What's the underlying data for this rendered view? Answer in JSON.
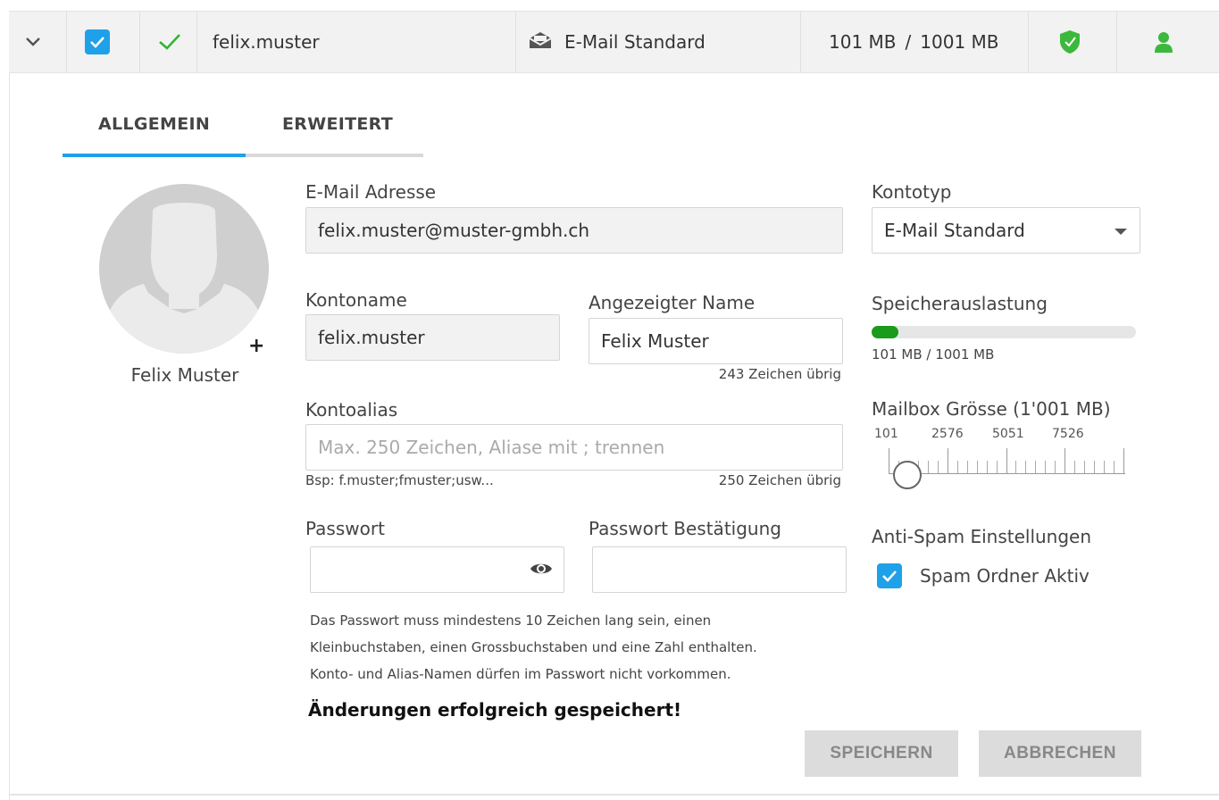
{
  "row": {
    "username": "felix.muster",
    "account_type": "E-Mail Standard",
    "quota_used": "101 MB",
    "quota_sep": "/",
    "quota_total": "1001 MB"
  },
  "tabs": [
    {
      "label": "ALLGEMEIN"
    },
    {
      "label": "ERWEITERT"
    }
  ],
  "profile": {
    "name": "Felix Muster",
    "add_label": "+"
  },
  "form": {
    "email_label": "E-Mail Adresse",
    "email_value": "felix.muster@muster-gmbh.ch",
    "kontoname_label": "Kontoname",
    "kontoname_value": "felix.muster",
    "display_name_label": "Angezeigter Name",
    "display_name_value": "Felix Muster",
    "display_name_remaining": "243 Zeichen übrig",
    "alias_label": "Kontoalias",
    "alias_placeholder": "Max. 250 Zeichen, Aliase mit ; trennen",
    "alias_example": "Bsp: f.muster;fmuster;usw...",
    "alias_remaining": "250 Zeichen übrig",
    "password_label": "Passwort",
    "password_confirm_label": "Passwort Bestätigung",
    "password_note_1": "Das Passwort muss mindestens 10 Zeichen lang sein, einen",
    "password_note_2": "Kleinbuchstaben, einen Grossbuchstaben und eine Zahl enthalten.",
    "password_note_3": "Konto- und Alias-Namen dürfen im Passwort nicht vorkommen.",
    "success_message": "Änderungen erfolgreich gespeichert!"
  },
  "side": {
    "kontotyp_label": "Kontotyp",
    "kontotyp_value": "E-Mail Standard",
    "storage_label": "Speicherauslastung",
    "storage_text": "101 MB / 1001 MB",
    "storage_fraction": 0.1,
    "mailbox_label": "Mailbox Grösse (1'001 MB)",
    "slider_ticks": [
      "101",
      "2576",
      "5051",
      "7526"
    ],
    "antispam_label": "Anti-Spam Einstellungen",
    "spam_folder_label": "Spam Ordner Aktiv",
    "spam_folder_checked": true
  },
  "buttons": {
    "save": "SPEICHERN",
    "cancel": "ABBRECHEN"
  },
  "colors": {
    "accent": "#1ea1e8",
    "success_green": "#2db52d",
    "progress_green": "#1a9b1a"
  },
  "icons": [
    "chevron-down-icon",
    "checkbox-icon",
    "check-icon",
    "envelope-open-icon",
    "shield-icon",
    "person-icon",
    "eye-icon",
    "caret-down-icon"
  ]
}
